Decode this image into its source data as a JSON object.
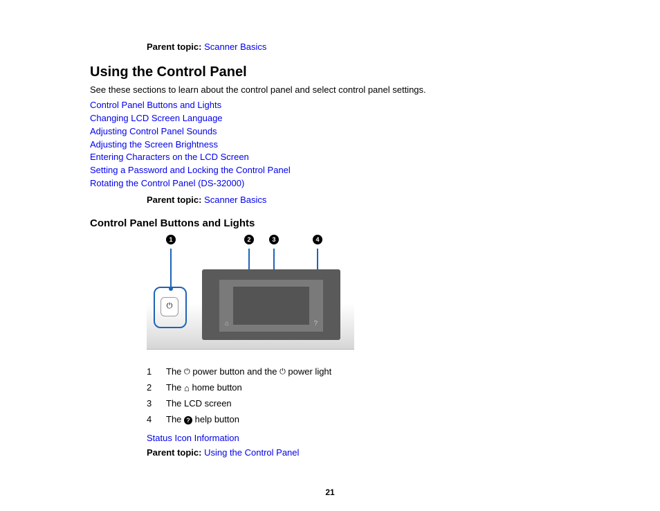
{
  "topParent": {
    "label": "Parent topic:",
    "link": "Scanner Basics"
  },
  "heading1": "Using the Control Panel",
  "intro": "See these sections to learn about the control panel and select control panel settings.",
  "tocLinks": [
    "Control Panel Buttons and Lights",
    "Changing LCD Screen Language",
    "Adjusting Control Panel Sounds",
    "Adjusting the Screen Brightness",
    "Entering Characters on the LCD Screen",
    "Setting a Password and Locking the Control Panel",
    "Rotating the Control Panel (DS-32000)"
  ],
  "parent2": {
    "label": "Parent topic:",
    "link": "Scanner Basics"
  },
  "heading2": "Control Panel Buttons and Lights",
  "callouts": [
    "1",
    "2",
    "3",
    "4"
  ],
  "legend": [
    {
      "ix": "1",
      "pre": "The ",
      "icon": "power",
      "mid": " power button and the ",
      "icon2": "power",
      "post": " power light"
    },
    {
      "ix": "2",
      "pre": "The ",
      "icon": "home",
      "mid": "",
      "icon2": null,
      "post": " home button"
    },
    {
      "ix": "3",
      "pre": "The LCD screen",
      "icon": null,
      "mid": "",
      "icon2": null,
      "post": ""
    },
    {
      "ix": "4",
      "pre": "The ",
      "icon": "help",
      "mid": "",
      "icon2": null,
      "post": " help button"
    }
  ],
  "subLink": "Status Icon Information",
  "parent3": {
    "label": "Parent topic:",
    "link": "Using the Control Panel"
  },
  "pageNumber": "21"
}
